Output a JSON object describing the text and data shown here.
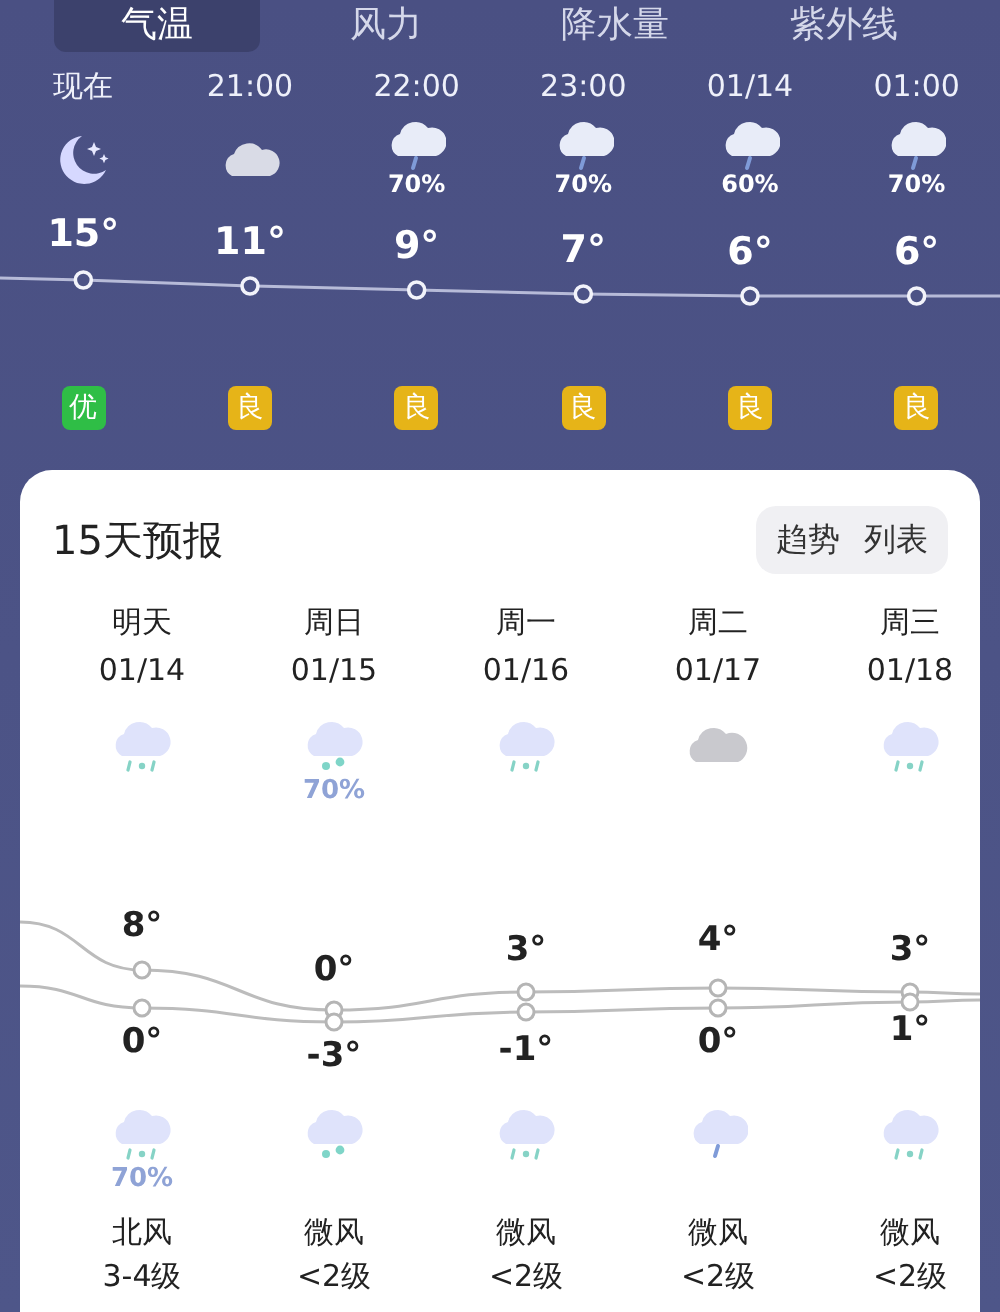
{
  "tabs": [
    {
      "label": "气温",
      "selected": true
    },
    {
      "label": "风力",
      "selected": false
    },
    {
      "label": "降水量",
      "selected": false
    },
    {
      "label": "紫外线",
      "selected": false
    }
  ],
  "hourly": [
    {
      "time": "现在",
      "icon": {
        "kind": "moon"
      },
      "temp": "15°",
      "aqi": "优",
      "color": "#2fbe46"
    },
    {
      "time": "21:00",
      "icon": {
        "kind": "cloud"
      },
      "temp": "11°",
      "aqi": "良",
      "color": "#e6b418"
    },
    {
      "time": "22:00",
      "icon": {
        "kind": "rain"
      },
      "precip": "70%",
      "temp": "9°",
      "aqi": "良",
      "color": "#e6b418"
    },
    {
      "time": "23:00",
      "icon": {
        "kind": "rain"
      },
      "precip": "70%",
      "temp": "7°",
      "aqi": "良",
      "color": "#e6b418"
    },
    {
      "time": "01/14",
      "icon": {
        "kind": "rain"
      },
      "precip": "60%",
      "temp": "6°",
      "aqi": "良",
      "color": "#e6b418"
    },
    {
      "time": "01:00",
      "icon": {
        "kind": "rain"
      },
      "precip": "70%",
      "temp": "6°",
      "aqi": "良",
      "color": "#e6b418"
    }
  ],
  "forecast": {
    "title": "15天预报",
    "views": [
      "趋势",
      "列表"
    ],
    "days": [
      {
        "day": "明天",
        "date": "01/14",
        "day_icon": {
          "kind": "sleet"
        },
        "high": "8°",
        "low": "0°",
        "night_icon": {
          "kind": "sleet"
        },
        "night_precip": "70%",
        "wind": "北风",
        "wind_level": "3-4级"
      },
      {
        "day": "周日",
        "date": "01/15",
        "day_icon": {
          "kind": "snow"
        },
        "day_precip": "70%",
        "high": "0°",
        "low": "-3°",
        "night_icon": {
          "kind": "snow"
        },
        "wind": "微风",
        "wind_level": "<2级"
      },
      {
        "day": "周一",
        "date": "01/16",
        "day_icon": {
          "kind": "sleet"
        },
        "high": "3°",
        "low": "-1°",
        "night_icon": {
          "kind": "sleet"
        },
        "wind": "微风",
        "wind_level": "<2级"
      },
      {
        "day": "周二",
        "date": "01/17",
        "day_icon": {
          "kind": "overcast"
        },
        "high": "4°",
        "low": "0°",
        "night_icon": {
          "kind": "rain"
        },
        "wind": "微风",
        "wind_level": "<2级"
      },
      {
        "day": "周三",
        "date": "01/18",
        "day_icon": {
          "kind": "sleet"
        },
        "high": "3°",
        "low": "1°",
        "night_icon": {
          "kind": "sleet"
        },
        "wind": "微风",
        "wind_level": "<2级"
      }
    ]
  }
}
